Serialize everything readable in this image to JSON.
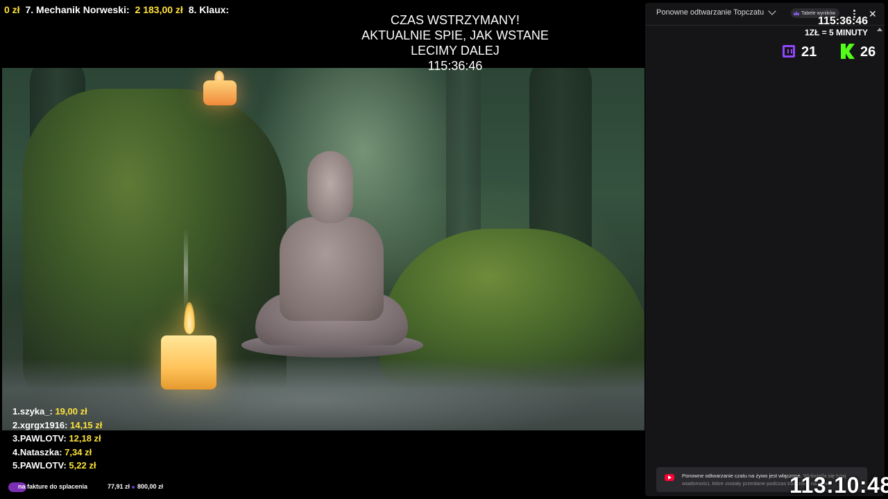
{
  "ticker": {
    "item6_amount": "0 zł",
    "item7_rank": "7.",
    "item7_name": "Mechanik Norweski:",
    "item7_amount": "2 183,00 zł",
    "item8_rank": "8.",
    "item8_name": "Klaux:"
  },
  "pause": {
    "line1": "CZAS WSTRZYMANY!",
    "line2": "AKTUALNIE SPIE, JAK WSTANE",
    "line3": "LECIMY DALEJ",
    "time": "115:36:46"
  },
  "leaderboard": [
    {
      "rank": "1.",
      "name": "szyka_:",
      "amount": "19,00 zł"
    },
    {
      "rank": "2.",
      "name": "xgrgx1916:",
      "amount": "14,15 zł"
    },
    {
      "rank": "3.",
      "name": "PAWLOTV:",
      "amount": "12,18 zł"
    },
    {
      "rank": "4.",
      "name": "Nataszka:",
      "amount": "7,34 zł"
    },
    {
      "rank": "5.",
      "name": "PAWLOTV:",
      "amount": "5,22 zł"
    }
  ],
  "goal": {
    "label": "na fakture do splacenia",
    "current": "77,91 zł",
    "target": "800,00 zł",
    "progress_fraction": 0.097
  },
  "chat": {
    "title": "Ponowne odtwarzanie Topczatu",
    "leaderboard_chip": "Tabele wyników",
    "notice_text": "Ponowne odtwarzanie czatu na żywo jest włączone.",
    "notice_dim": "Wyświetla się tutaj wiadomości, które zostały przesłane podczas transmisji na żywo."
  },
  "stream_overlay": {
    "timer": "115:36:46",
    "rate": "1ZŁ = 5 MINUTY",
    "twitch_viewers": "21",
    "kick_viewers": "26",
    "big_timer": "113:10:48"
  },
  "colors": {
    "accent_gold": "#ffe23a",
    "twitch": "#9146ff",
    "kick": "#53fc18",
    "youtube": "#ff0033"
  },
  "icons": [
    "twitch-icon",
    "kick-icon",
    "youtube-icon",
    "crown-icon",
    "chevron-down-icon",
    "more-vertical-icon",
    "close-icon"
  ]
}
